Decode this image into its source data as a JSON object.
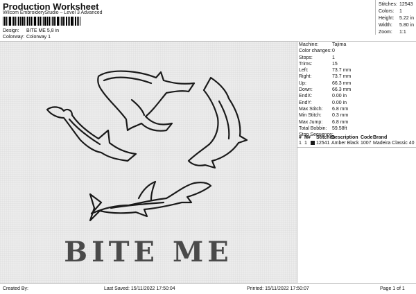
{
  "header": {
    "title": "Production Worksheet",
    "subtitle": "Wilcom EmbroideryStudio – Level 3 Advanced"
  },
  "design_meta": [
    {
      "key": "Design:",
      "value": "BITE ME 5,8 in"
    },
    {
      "key": "Colorway:",
      "value": "Colorway 1"
    }
  ],
  "top_stats": [
    {
      "key": "Stitches:",
      "value": "12543"
    },
    {
      "key": "Colors:",
      "value": "1"
    },
    {
      "key": "Height:",
      "value": "5.22 in"
    },
    {
      "key": "Width:",
      "value": "5.80 in"
    },
    {
      "key": "Zoom:",
      "value": "1:1"
    }
  ],
  "machine_info": [
    {
      "key": "Machine:",
      "value": "Tajima"
    },
    {
      "key": "Color changes:",
      "value": "0"
    },
    {
      "key": "Stops:",
      "value": "1"
    },
    {
      "key": "Trims:",
      "value": "15"
    },
    {
      "key": "Left:",
      "value": "73.7 mm"
    },
    {
      "key": "Right:",
      "value": "73.7 mm"
    },
    {
      "key": "Up:",
      "value": "66.3 mm"
    },
    {
      "key": "Down:",
      "value": "66.3 mm"
    },
    {
      "key": "EndX:",
      "value": "0.00 in"
    },
    {
      "key": "EndY:",
      "value": "0.00 in"
    },
    {
      "key": "Max Stitch:",
      "value": "6.8 mm"
    },
    {
      "key": "Min Stitch:",
      "value": "0.3 mm"
    },
    {
      "key": "Max Jump:",
      "value": "6.8 mm"
    },
    {
      "key": "Total Bobbin:",
      "value": "59.58ft"
    }
  ],
  "stop_sequence": {
    "label": "Stop Sequence:",
    "headers": [
      "#",
      "N#",
      "",
      "Stitches",
      "Description",
      "Code",
      "Brand"
    ],
    "rows": [
      {
        "num": "1",
        "n": "1",
        "swatch_color": "#1a1a1a",
        "stitches": "12541",
        "description": "Amber Black",
        "code": "1007",
        "brand": "Madeira Classic 40"
      }
    ]
  },
  "design": {
    "text": "BITE ME",
    "stitch_color": "#1a1a1a",
    "fill_color": "#4a4a4a"
  },
  "footer": {
    "created_by": "Created By:",
    "last_saved": "Last Saved: 15/11/2022 17:50:04",
    "printed": "Printed: 15/11/2022 17:50:07",
    "page": "Page 1 of 1"
  }
}
